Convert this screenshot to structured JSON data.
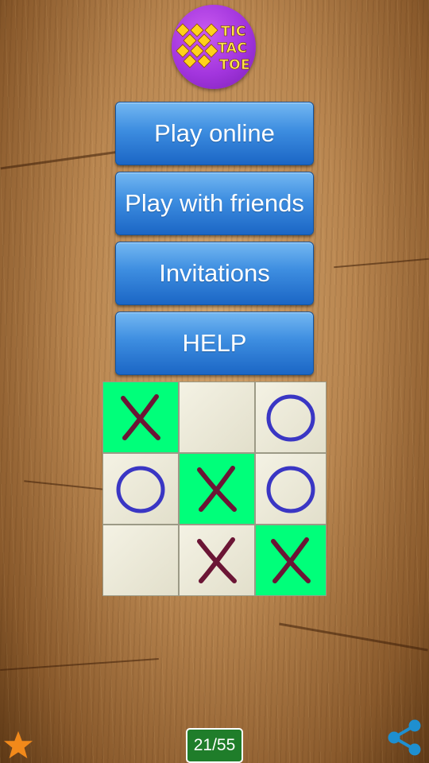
{
  "logo": {
    "line1": "TIC",
    "line2": "TAC",
    "line3": "TOE",
    "colors": {
      "circle": "#a235dd",
      "text": "#ffe34a",
      "diamonds": "#ffd21a"
    }
  },
  "menu": {
    "play_online": "Play online",
    "play_with_friends": "Play with friends",
    "invitations": "Invitations",
    "help": "HELP"
  },
  "board": {
    "cells": [
      [
        "X",
        "",
        "O"
      ],
      [
        "O",
        "X",
        "O"
      ],
      [
        "",
        "X",
        "X"
      ]
    ],
    "winning_cells": [
      "r0c0",
      "r1c1",
      "r2c2"
    ],
    "colors": {
      "x": "#6b1535",
      "o": "#3a36c4",
      "win": "#00ff7a",
      "cell": "#ecead8"
    }
  },
  "footer": {
    "rate_icon": "star-icon",
    "level_counter": "21/55",
    "share_icon": "share-icon",
    "colors": {
      "star": "#f2891a",
      "counter_bg": "#1f7d2a",
      "share": "#1e8fd0"
    }
  }
}
